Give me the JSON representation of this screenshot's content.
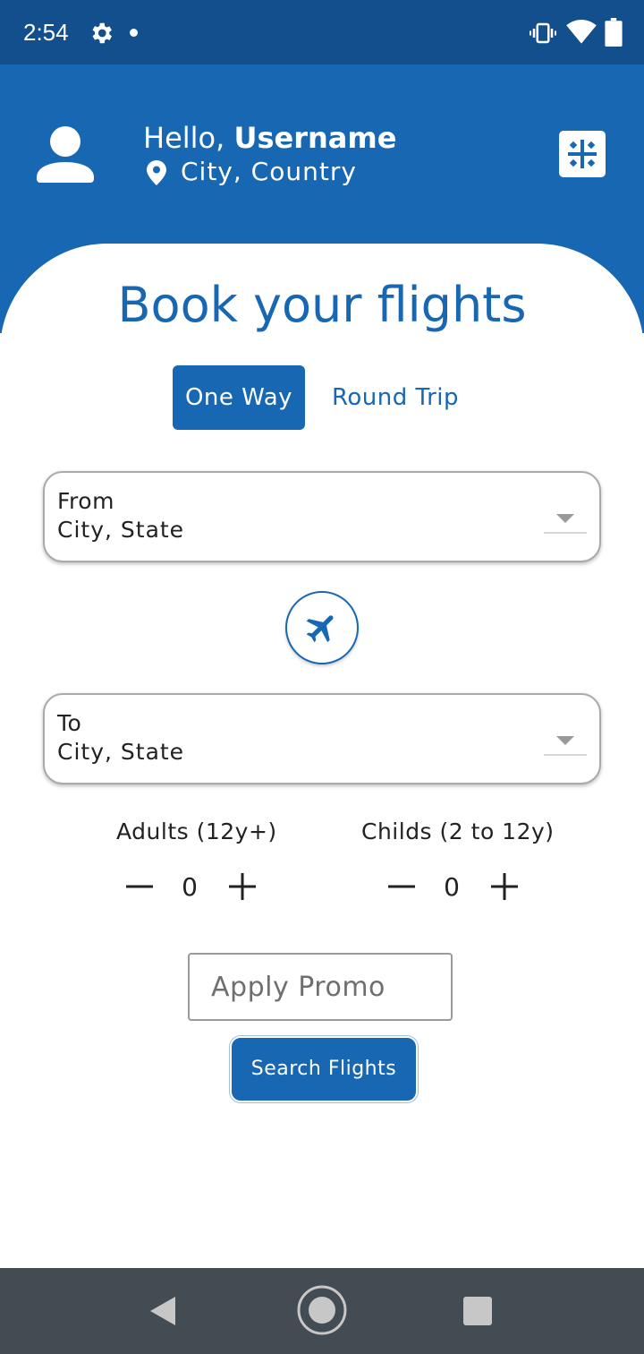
{
  "status_bar": {
    "time": "2:54",
    "icons": [
      "gear-icon",
      "notification-dot",
      "vibrate-icon",
      "wifi-icon",
      "battery-icon"
    ]
  },
  "header": {
    "greeting_prefix": "Hello, ",
    "username": "Username",
    "location": "City, Country",
    "icons": [
      "user-avatar-icon",
      "location-pin-icon",
      "menu-grid-icon"
    ]
  },
  "main": {
    "title": "Book your flights",
    "tabs": [
      {
        "label": "One Way",
        "selected": true
      },
      {
        "label": "Round Trip",
        "selected": false
      }
    ],
    "from_field": {
      "label": "From",
      "value": "City, State"
    },
    "to_field": {
      "label": "To",
      "value": "City, State"
    },
    "swap_icon": "airplane-icon",
    "passengers": {
      "adults": {
        "label": "Adults (12y+)",
        "count": "0"
      },
      "childs": {
        "label": "Childs (2 to 12y)",
        "count": "0"
      }
    },
    "promo": {
      "placeholder": "Apply Promo",
      "value": ""
    },
    "search_button": "Search Flights"
  },
  "colors": {
    "status_bar": "#124f8c",
    "primary": "#1767b3",
    "nav_bar": "#434b53"
  },
  "nav_bar": {
    "icons": [
      "back-icon",
      "home-icon",
      "recents-icon"
    ]
  }
}
